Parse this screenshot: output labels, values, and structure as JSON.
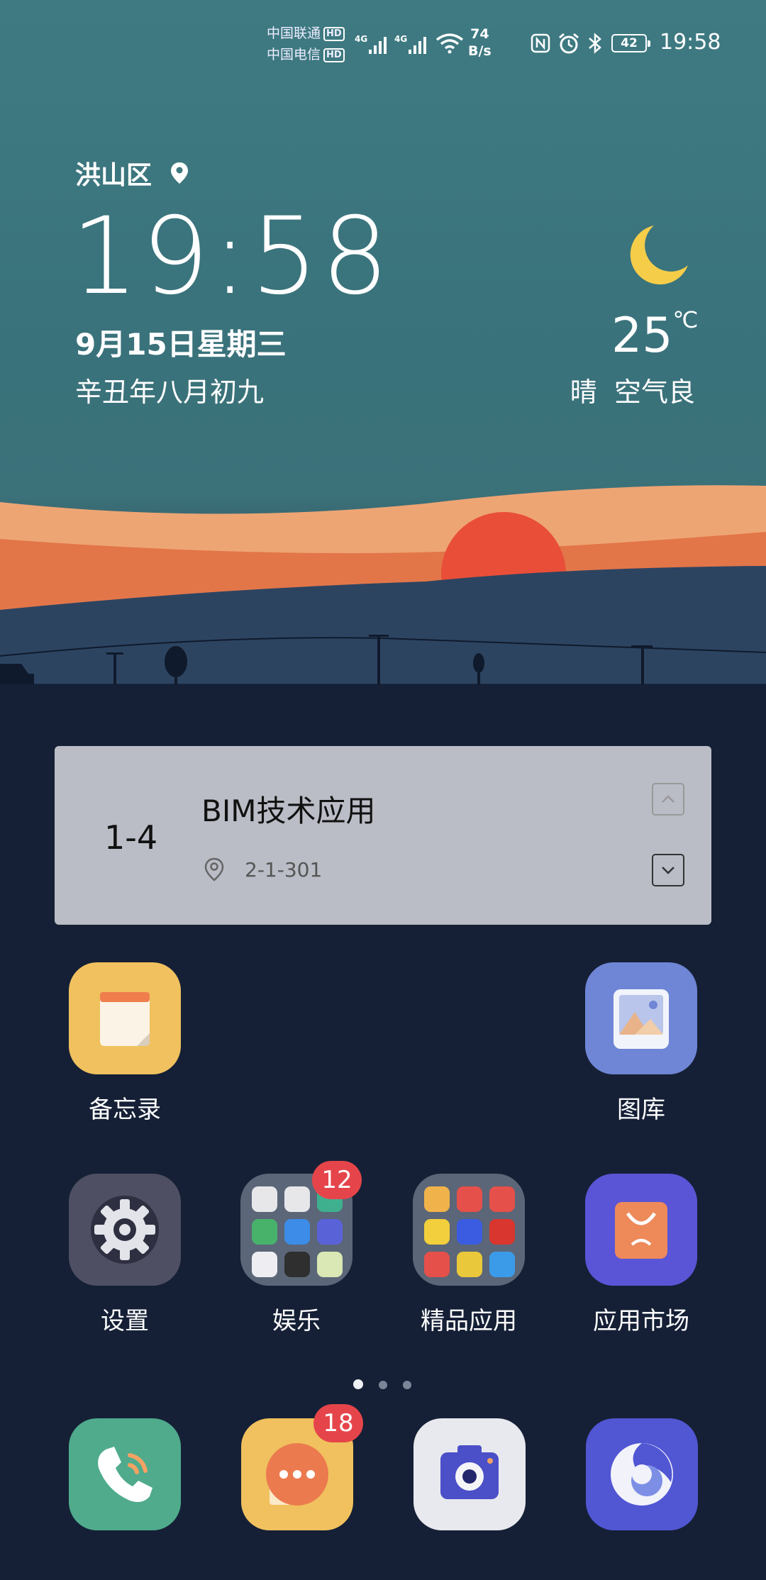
{
  "status_bar": {
    "carrier1": "中国联通",
    "carrier2": "中国电信",
    "hd": "HD",
    "net1": "4G",
    "net2": "4G",
    "speed_value": "74",
    "speed_unit": "B/s",
    "battery": "42",
    "time": "19:58",
    "icons": [
      "nfc-icon",
      "alarm-icon",
      "bluetooth-icon",
      "wifi-icon",
      "signal-icon"
    ]
  },
  "clock_widget": {
    "location": "洪山区",
    "time": "19:58",
    "date": "9月15日星期三",
    "lunar": "辛丑年八月初九",
    "temperature": "25",
    "temp_unit": "℃",
    "condition": "晴",
    "air_quality": "空气良",
    "weather_icon": "moon-icon"
  },
  "course_card": {
    "index": "1-4",
    "title": "BIM技术应用",
    "room": "2-1-301"
  },
  "apps_row1": [
    {
      "label": "备忘录",
      "icon": "notepad-icon",
      "color": "#f0c15e"
    },
    {
      "label": "图库",
      "icon": "gallery-icon",
      "color": "#6f86d6"
    }
  ],
  "apps_row2": [
    {
      "label": "设置",
      "icon": "settings-icon",
      "color": "#4e4f62"
    },
    {
      "label": "娱乐",
      "icon": "folder-icon",
      "badge": "12"
    },
    {
      "label": "精品应用",
      "icon": "folder-icon"
    },
    {
      "label": "应用市场",
      "icon": "appstore-icon",
      "color": "#5a55d6"
    }
  ],
  "page_indicator": {
    "pages": 3,
    "current": 1
  },
  "dock": [
    {
      "name": "phone",
      "icon": "phone-icon",
      "color": "#4fab8c"
    },
    {
      "name": "messages",
      "icon": "message-icon",
      "color": "#f0c15e",
      "badge": "18"
    },
    {
      "name": "camera",
      "icon": "camera-icon",
      "color": "#e8e9ee"
    },
    {
      "name": "browser",
      "icon": "browser-icon",
      "color": "#5156d3"
    }
  ]
}
